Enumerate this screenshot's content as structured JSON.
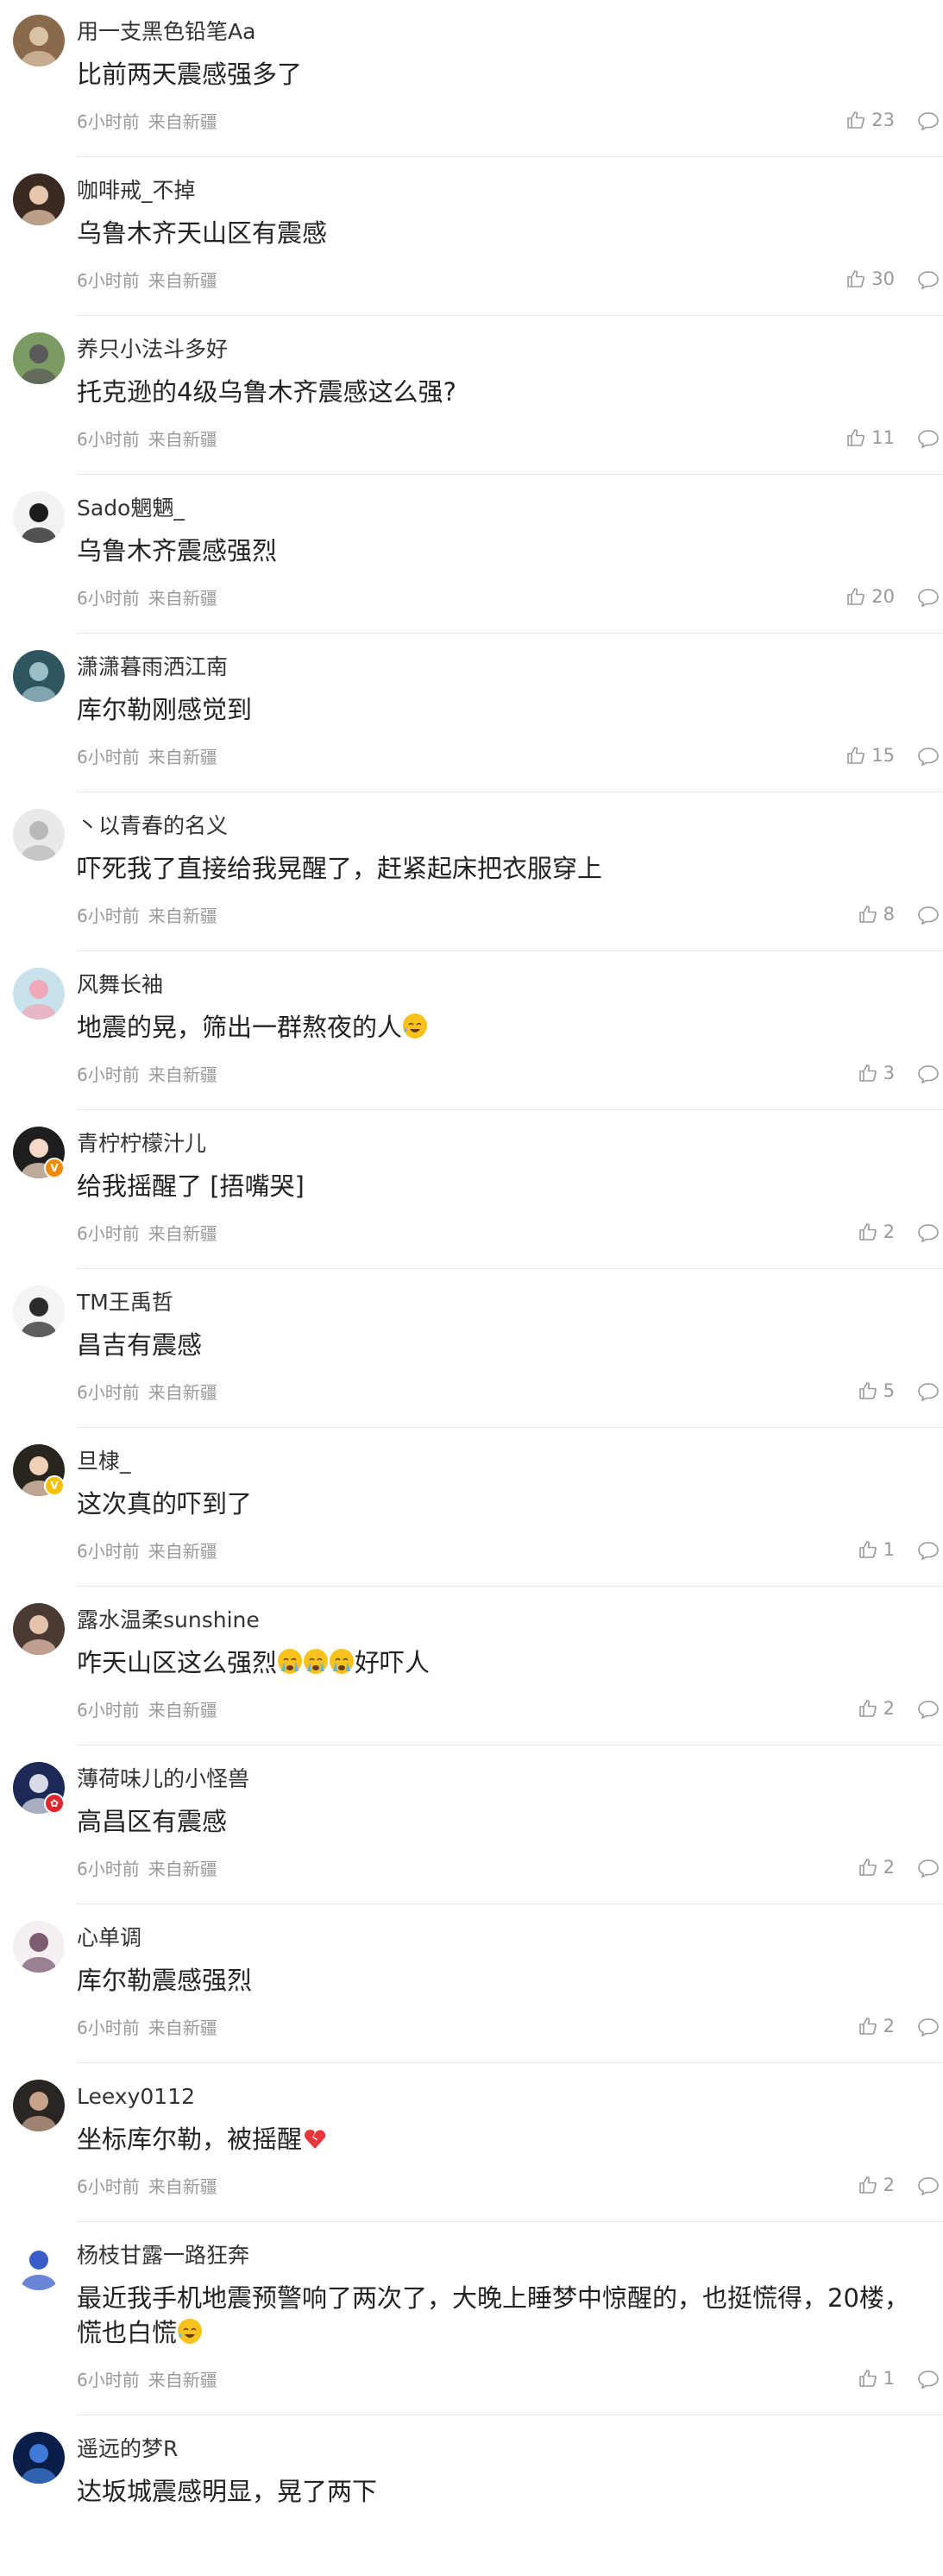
{
  "comments": [
    {
      "username": "用一支黑色铅笔Aa",
      "content": "比前两天震感强多了",
      "time": "6小时前",
      "location": "来自新疆",
      "likes": "23",
      "avatar_color": "#8a6a4a",
      "avatar_accent": "#d9c3a5"
    },
    {
      "username": "咖啡戒_不掉",
      "content": "乌鲁木齐天山区有震感",
      "time": "6小时前",
      "location": "来自新疆",
      "likes": "30",
      "avatar_color": "#3b2a22",
      "avatar_accent": "#e7c7ac"
    },
    {
      "username": "养只小法斗多好",
      "content": "托克逊的4级乌鲁木齐震感这么强?",
      "time": "6小时前",
      "location": "来自新疆",
      "likes": "11",
      "avatar_color": "#7c9b63",
      "avatar_accent": "#5a5a5a"
    },
    {
      "username": "Sado魍魉_",
      "content": "乌鲁木齐震感强烈",
      "time": "6小时前",
      "location": "来自新疆",
      "likes": "20",
      "avatar_color": "#f2f2f2",
      "avatar_accent": "#1c1c1c"
    },
    {
      "username": "潇潇暮雨洒江南",
      "content": "库尔勒刚感觉到",
      "time": "6小时前",
      "location": "来自新疆",
      "likes": "15",
      "avatar_color": "#2f5561",
      "avatar_accent": "#9cc0c8"
    },
    {
      "username": "丶以青春的名义",
      "content": "吓死我了直接给我晃醒了，赶紧起床把衣服穿上",
      "time": "6小时前",
      "location": "来自新疆",
      "likes": "8",
      "avatar_color": "#e9e9e9",
      "avatar_accent": "#b9b9b9"
    },
    {
      "username": "风舞长袖",
      "content": "地震的晃，筛出一群熬夜的人",
      "emoji_after": "laugh-cry-emoji",
      "time": "6小时前",
      "location": "来自新疆",
      "likes": "3",
      "avatar_color": "#c7e2ec",
      "avatar_accent": "#f0a8b8"
    },
    {
      "username": "青柠柠檬汁儿",
      "content": "给我摇醒了 [捂嘴哭]",
      "time": "6小时前",
      "location": "来自新疆",
      "likes": "2",
      "avatar_color": "#1e1e1e",
      "avatar_accent": "#f3d9c6",
      "badge": "V",
      "badge_color": "#f28a00"
    },
    {
      "username": "TM王禹哲",
      "content": "昌吉有震感",
      "time": "6小时前",
      "location": "来自新疆",
      "likes": "5",
      "avatar_color": "#f4f4f4",
      "avatar_accent": "#2b2b2b"
    },
    {
      "username": "旦棣_",
      "content": "这次真的吓到了",
      "time": "6小时前",
      "location": "来自新疆",
      "likes": "1",
      "avatar_color": "#2a241f",
      "avatar_accent": "#efd1b8",
      "badge": "V",
      "badge_color": "#f5c000"
    },
    {
      "username": "露水温柔sunshine",
      "content": "咋天山区这么强烈",
      "emoji_after_list": [
        "crying-emoji",
        "crying-emoji",
        "crying-emoji"
      ],
      "content_suffix": "好吓人",
      "time": "6小时前",
      "location": "来自新疆",
      "likes": "2",
      "avatar_color": "#4b3a33",
      "avatar_accent": "#e6c3ad"
    },
    {
      "username": "薄荷味儿的小怪兽",
      "content": "高昌区有震感",
      "time": "6小时前",
      "location": "来自新疆",
      "likes": "2",
      "avatar_color": "#1c2a55",
      "avatar_accent": "#d8dce8",
      "badge": "✿",
      "badge_color": "#e0262e"
    },
    {
      "username": "心单调",
      "content": "库尔勒震感强烈",
      "time": "6小时前",
      "location": "来自新疆",
      "likes": "2",
      "avatar_color": "#f5eef2",
      "avatar_accent": "#7b5c70"
    },
    {
      "username": "Leexy0112",
      "content": "坐标库尔勒，被摇醒",
      "emoji_after": "broken-heart-emoji",
      "time": "6小时前",
      "location": "来自新疆",
      "likes": "2",
      "avatar_color": "#2a2522",
      "avatar_accent": "#c7a38c"
    },
    {
      "username": "杨枝甘露一路狂奔",
      "content": "最近我手机地震预警响了两次了，大晚上睡梦中惊醒的，也挺慌得，20楼，慌也白慌",
      "emoji_after": "laugh-cry-emoji",
      "time": "6小时前",
      "location": "来自新疆",
      "likes": "1",
      "avatar_color": "#ffffff",
      "avatar_accent": "#3a5cc8"
    },
    {
      "username": "遥远的梦R",
      "content": "达坂城震感明显，晃了两下",
      "avatar_color": "#0a1e4a",
      "avatar_accent": "#3f7ad6"
    }
  ]
}
